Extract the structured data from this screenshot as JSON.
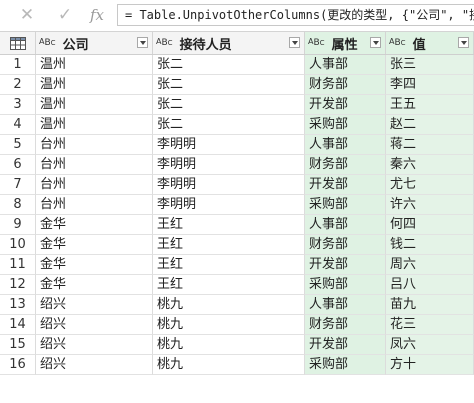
{
  "formula_bar": {
    "cancel_icon": "close-icon",
    "confirm_icon": "check-icon",
    "fx_label": "fx",
    "formula": "= Table.UnpivotOtherColumns(更改的类型, {\"公司\", \"接待人"
  },
  "table": {
    "columns": [
      {
        "label": "公司",
        "type_icon": "ABC"
      },
      {
        "label": "接待人员",
        "type_icon": "ABC"
      },
      {
        "label": "属性",
        "type_icon": "ABC"
      },
      {
        "label": "值",
        "type_icon": "ABC"
      }
    ],
    "rows": [
      [
        "1",
        "温州",
        "张二",
        "人事部",
        "张三"
      ],
      [
        "2",
        "温州",
        "张二",
        "财务部",
        "李四"
      ],
      [
        "3",
        "温州",
        "张二",
        "开发部",
        "王五"
      ],
      [
        "4",
        "温州",
        "张二",
        "采购部",
        "赵二"
      ],
      [
        "5",
        "台州",
        "李明明",
        "人事部",
        "蒋二"
      ],
      [
        "6",
        "台州",
        "李明明",
        "财务部",
        "秦六"
      ],
      [
        "7",
        "台州",
        "李明明",
        "开发部",
        "尤七"
      ],
      [
        "8",
        "台州",
        "李明明",
        "采购部",
        "许六"
      ],
      [
        "9",
        "金华",
        "王红",
        "人事部",
        "何四"
      ],
      [
        "10",
        "金华",
        "王红",
        "财务部",
        "钱二"
      ],
      [
        "11",
        "金华",
        "王红",
        "开发部",
        "周六"
      ],
      [
        "12",
        "金华",
        "王红",
        "采购部",
        "吕八"
      ],
      [
        "13",
        "绍兴",
        "桃九",
        "人事部",
        "苗九"
      ],
      [
        "14",
        "绍兴",
        "桃九",
        "财务部",
        "花三"
      ],
      [
        "15",
        "绍兴",
        "桃九",
        "开发部",
        "凤六"
      ],
      [
        "16",
        "绍兴",
        "桃九",
        "采购部",
        "方十"
      ]
    ]
  },
  "colors": {
    "highlight": "#dff2e3",
    "header_bg": "#f4f4f4"
  }
}
